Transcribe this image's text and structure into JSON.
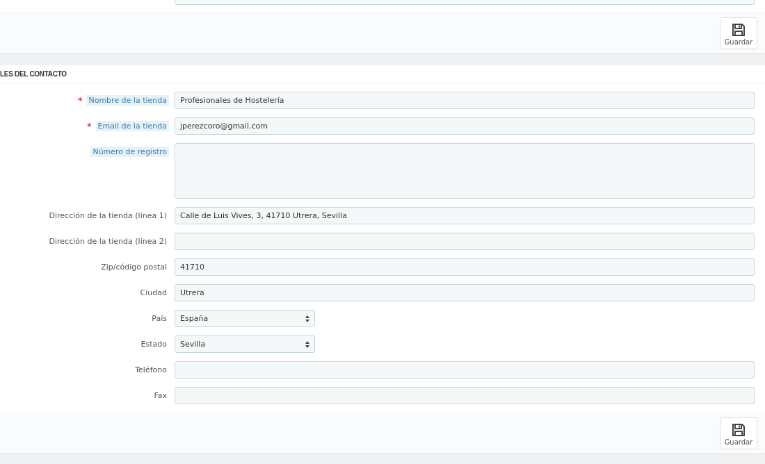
{
  "top_panel": {
    "save_button": "Guardar"
  },
  "contact_panel": {
    "heading": "LES DEL CONTACTO",
    "fields": [
      {
        "kind": "text",
        "label": "Nombre de la tienda",
        "required_mark": "*",
        "hint": true,
        "value": "Profesionales de Hostelería"
      },
      {
        "kind": "text",
        "label": "Email de la tienda",
        "required_mark": "*",
        "hint": true,
        "value": "jperezcoro@gmail.com"
      },
      {
        "kind": "textarea",
        "label": "Número de registro",
        "hint": true
      },
      {
        "kind": "text",
        "label": "Dirección de la tienda (línea 1)",
        "hint": false,
        "value": "Calle de Luis Vives, 3, 41710 Utrera, Sevilla"
      },
      {
        "kind": "text",
        "label": "Dirección de la tienda (línea 2)",
        "hint": false
      },
      {
        "kind": "text",
        "label": "Zip/código postal",
        "hint": false,
        "value": "41710"
      },
      {
        "kind": "text",
        "label": "Ciudad",
        "hint": false,
        "value": "Utrera"
      },
      {
        "kind": "select",
        "label": "País",
        "hint": false,
        "value": "España"
      },
      {
        "kind": "select",
        "label": "Estado",
        "hint": false,
        "value": "Sevilla"
      },
      {
        "kind": "text",
        "label": "Teléfono",
        "hint": false
      },
      {
        "kind": "text",
        "label": "Fax",
        "hint": false
      }
    ],
    "save_button": "Guardar"
  }
}
